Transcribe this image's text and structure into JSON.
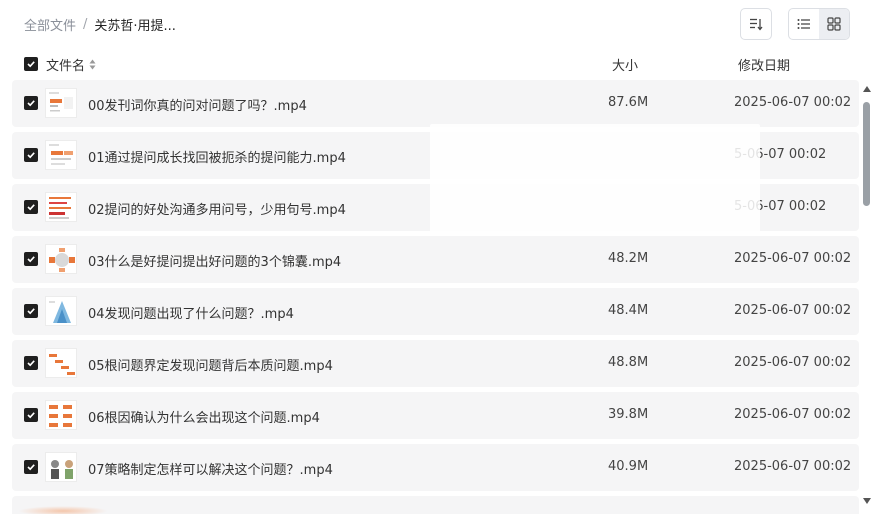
{
  "breadcrumb": {
    "root": "全部文件",
    "separator": "/",
    "current": "关苏哲·用提..."
  },
  "toolbar": {
    "sort_icon": "sort-list-icon",
    "views": [
      {
        "icon": "list-view-icon",
        "active": false
      },
      {
        "icon": "grid-view-icon",
        "active": true
      }
    ]
  },
  "header": {
    "name": "文件名",
    "size": "大小",
    "date": "修改日期"
  },
  "files": [
    {
      "name": "00发刊词你真的问对问题了吗？.mp4",
      "size": "87.6M",
      "date": "2025-06-07 00:02"
    },
    {
      "name": "01通过提问成长找回被扼杀的提问能力.mp4",
      "size": "",
      "date": "5-06-07 00:02"
    },
    {
      "name": "02提问的好处沟通多用问号，少用句号.mp4",
      "size": "",
      "date": "5-06-07 00:02"
    },
    {
      "name": "03什么是好提问提出好问题的3个锦囊.mp4",
      "size": "48.2M",
      "date": "2025-06-07 00:02"
    },
    {
      "name": "04发现问题出现了什么问题？.mp4",
      "size": "48.4M",
      "date": "2025-06-07 00:02"
    },
    {
      "name": "05根问题界定发现问题背后本质问题.mp4",
      "size": "48.8M",
      "date": "2025-06-07 00:02"
    },
    {
      "name": "06根因确认为什么会出现这个问题.mp4",
      "size": "39.8M",
      "date": "2025-06-07 00:02"
    },
    {
      "name": "07策略制定怎样可以解决这个问题？.mp4",
      "size": "40.9M",
      "date": "2025-06-07 00:02"
    }
  ],
  "colors": {
    "row_bg": "#f5f5f6",
    "checkbox": "#1f1f1f",
    "thumb_accent": "#e8773a"
  }
}
